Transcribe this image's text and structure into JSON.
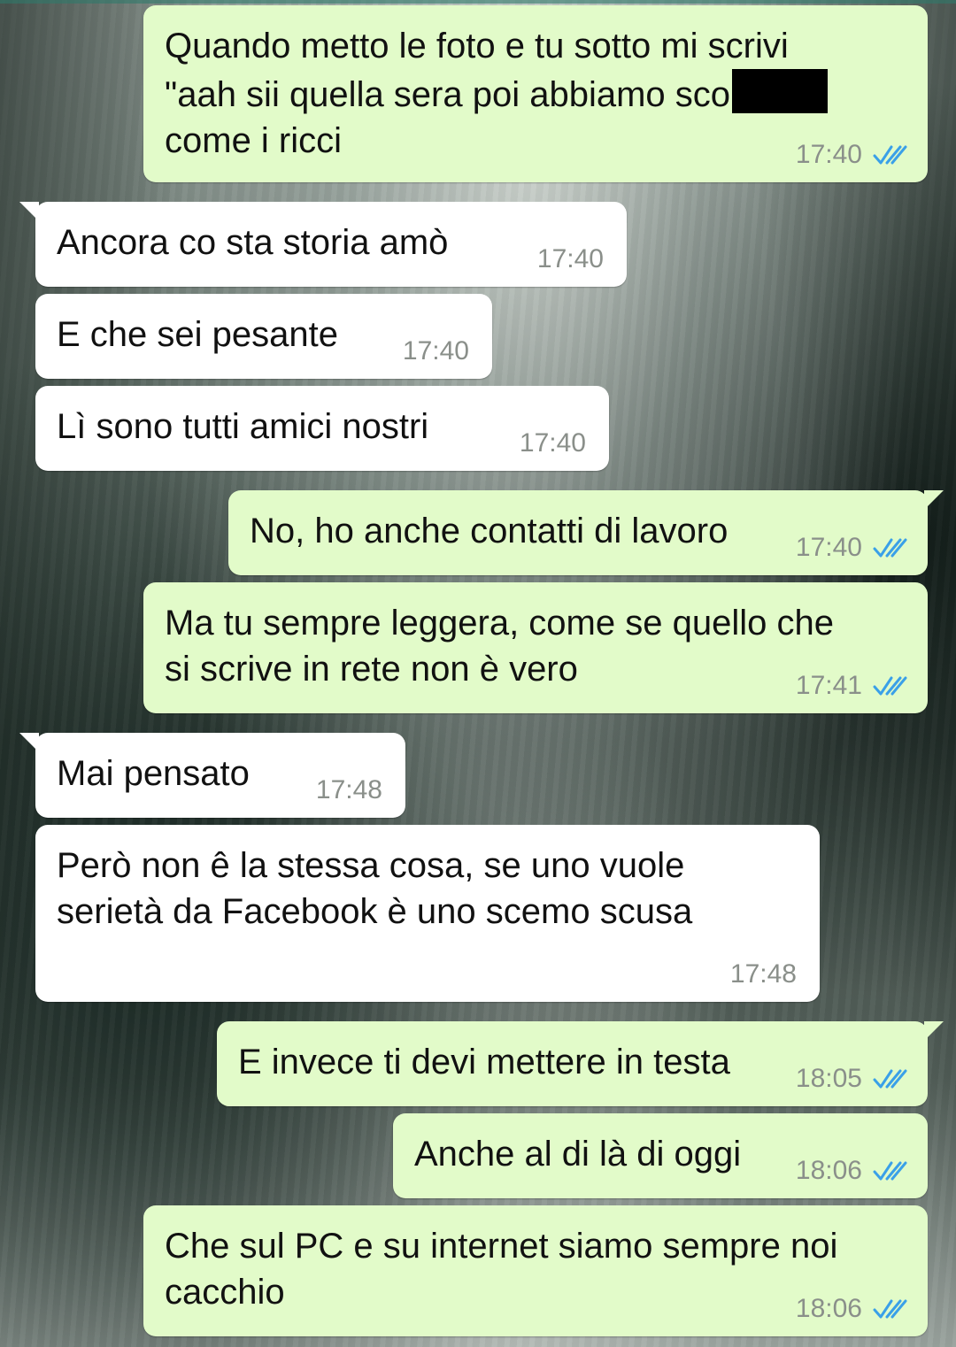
{
  "colors": {
    "outgoing_bubble": "#e2fbc9",
    "incoming_bubble": "#ffffff",
    "read_ticks": "#3aa0e8",
    "timestamp": "#8a8f8a"
  },
  "messages": [
    {
      "dir": "out",
      "line1": "Quando metto le foto e tu sotto mi scrivi",
      "line2": "\"aah sii quella sera poi abbiamo sco",
      "line3": "come i ricci",
      "time": "17:40",
      "status_icon": "double-check-icon"
    },
    {
      "dir": "in",
      "text": "Ancora co sta storia amò",
      "time": "17:40"
    },
    {
      "dir": "in",
      "text": "E che sei pesante",
      "time": "17:40"
    },
    {
      "dir": "in",
      "text": "Lì sono tutti amici nostri",
      "time": "17:40"
    },
    {
      "dir": "out",
      "text": "No, ho anche contatti di lavoro",
      "time": "17:40",
      "status_icon": "double-check-icon"
    },
    {
      "dir": "out",
      "text": "Ma tu sempre leggera, come se quello che\nsi scrive in rete non è vero",
      "time": "17:41",
      "status_icon": "double-check-icon"
    },
    {
      "dir": "in",
      "text": "Mai pensato",
      "time": "17:48"
    },
    {
      "dir": "in",
      "text": "Però non ê la stessa cosa, se uno vuole\nserietà da Facebook è uno scemo scusa",
      "time": "17:48"
    },
    {
      "dir": "out",
      "text": "E invece ti devi mettere in testa",
      "time": "18:05",
      "status_icon": "double-check-icon"
    },
    {
      "dir": "out",
      "text": "Anche al di là di oggi",
      "time": "18:06",
      "status_icon": "double-check-icon"
    },
    {
      "dir": "out",
      "text": "Che sul PC e su internet siamo sempre noi\ncacchio",
      "time": "18:06",
      "status_icon": "double-check-icon"
    }
  ]
}
